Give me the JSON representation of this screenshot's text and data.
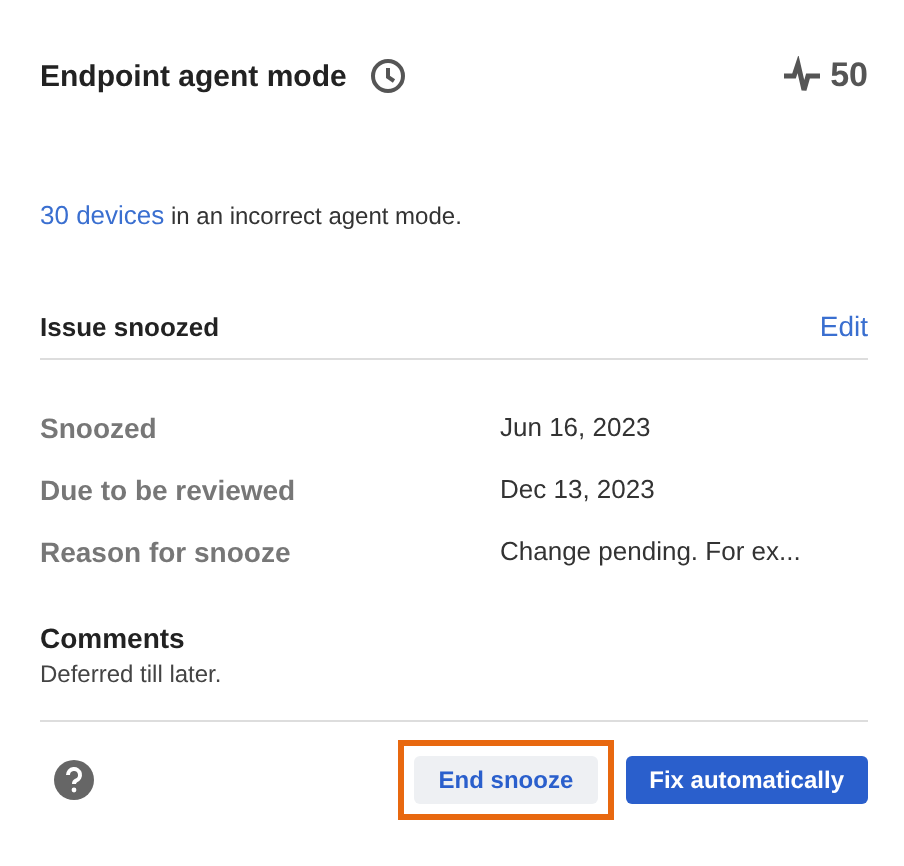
{
  "header": {
    "title": "Endpoint agent mode",
    "score": "50"
  },
  "summary": {
    "link": "30 devices",
    "text": " in an incorrect agent mode."
  },
  "snooze_section": {
    "title": "Issue snoozed",
    "action": "Edit",
    "rows": [
      {
        "label": "Snoozed",
        "value": "Jun 16, 2023"
      },
      {
        "label": "Due to be reviewed",
        "value": "Dec 13, 2023"
      },
      {
        "label": "Reason for snooze",
        "value": "Change pending. For ex..."
      }
    ]
  },
  "comments": {
    "title": "Comments",
    "text": "Deferred till later."
  },
  "buttons": [
    {
      "label": "End snooze",
      "kind": "secondary",
      "highlighted": true
    },
    {
      "label": "Fix automatically",
      "kind": "primary",
      "highlighted": false
    }
  ]
}
